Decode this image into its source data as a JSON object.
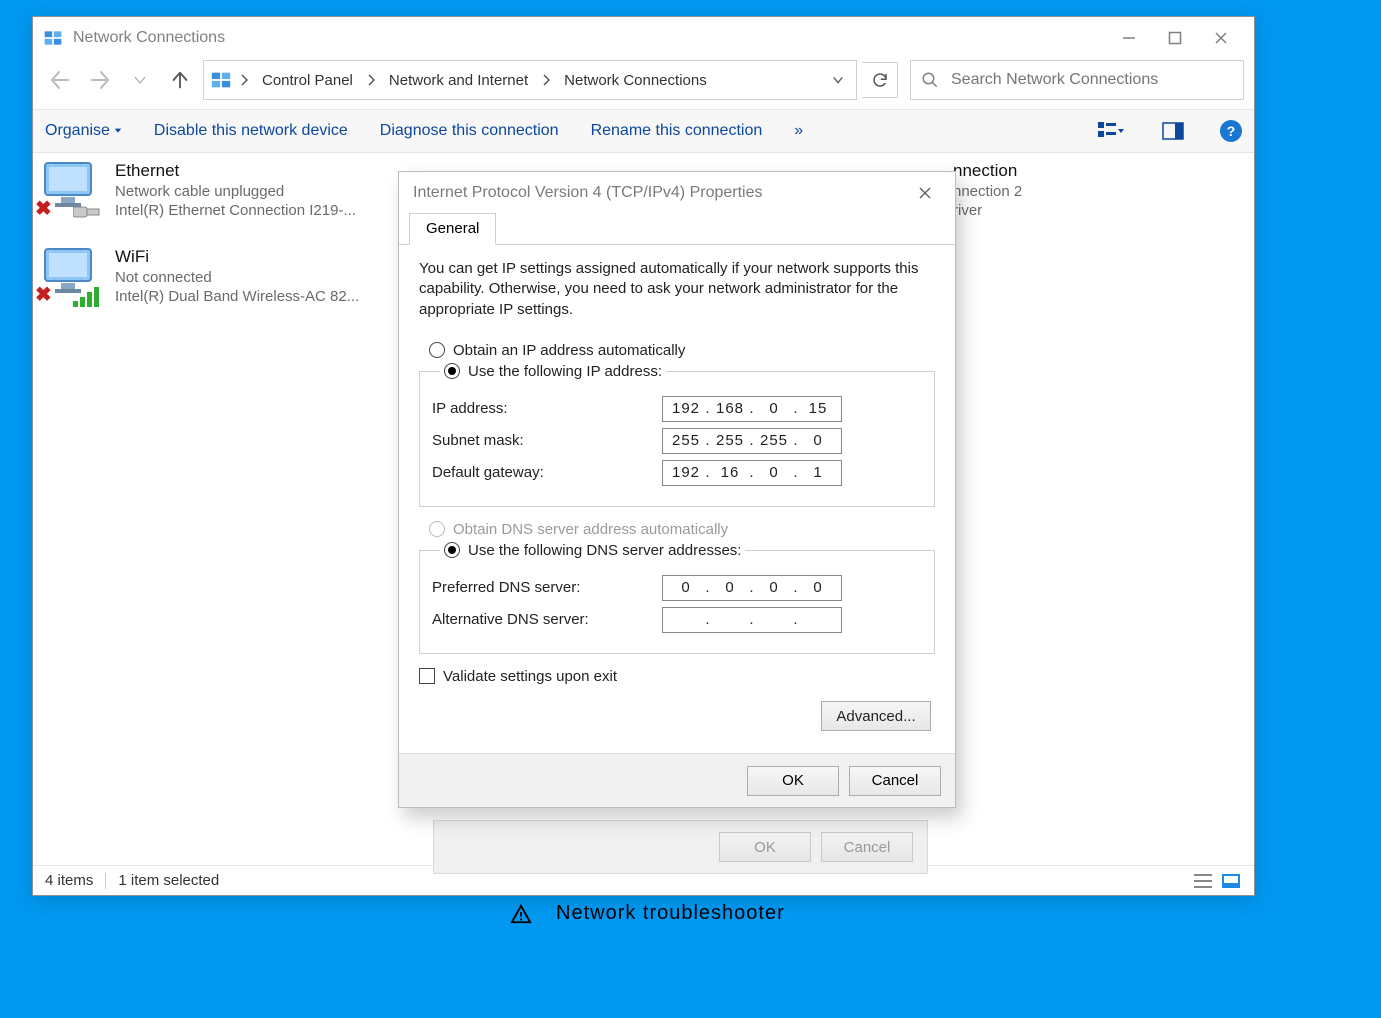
{
  "window": {
    "title": "Network Connections"
  },
  "breadcrumb": {
    "root": "Control Panel",
    "mid": "Network and Internet",
    "leaf": "Network Connections"
  },
  "search": {
    "placeholder": "Search Network Connections"
  },
  "commands": {
    "organise": "Organise",
    "disable": "Disable this network device",
    "diagnose": "Diagnose this connection",
    "rename": "Rename this connection",
    "more": "»"
  },
  "items": {
    "ethernet": {
      "title": "Ethernet",
      "status": "Network cable unplugged",
      "device": "Intel(R) Ethernet Connection I219-..."
    },
    "wifi": {
      "title": "WiFi",
      "status": "Not connected",
      "device": "Intel(R) Dual Band Wireless-AC 82..."
    },
    "bt": {
      "title_frag": "nnection",
      "sub1_frag": "nnection 2",
      "sub2_frag": "river"
    }
  },
  "statusbar": {
    "count": "4 items",
    "selection": "1 item selected"
  },
  "under_dialog": {
    "ok": "OK",
    "cancel": "Cancel"
  },
  "troubleshooter": "Network troubleshooter",
  "dialog": {
    "title": "Internet Protocol Version 4 (TCP/IPv4) Properties",
    "tab": "General",
    "intro": "You can get IP settings assigned automatically if your network supports this capability. Otherwise, you need to ask your network administrator for the appropriate IP settings.",
    "ip_auto": "Obtain an IP address automatically",
    "ip_manual": "Use the following IP address:",
    "ip_addr_label": "IP address:",
    "subnet_label": "Subnet mask:",
    "gateway_label": "Default gateway:",
    "ip_addr": {
      "o1": "192",
      "o2": "168",
      "o3": "0",
      "o4": "15"
    },
    "subnet": {
      "o1": "255",
      "o2": "255",
      "o3": "255",
      "o4": "0"
    },
    "gateway": {
      "o1": "192",
      "o2": "16",
      "o3": "0",
      "o4": "1"
    },
    "dns_auto": "Obtain DNS server address automatically",
    "dns_manual": "Use the following DNS server addresses:",
    "pref_dns_label": "Preferred DNS server:",
    "alt_dns_label": "Alternative DNS server:",
    "pref_dns": {
      "o1": "0",
      "o2": "0",
      "o3": "0",
      "o4": "0"
    },
    "alt_dns": {
      "o1": "",
      "o2": "",
      "o3": "",
      "o4": ""
    },
    "validate": "Validate settings upon exit",
    "advanced": "Advanced...",
    "ok": "OK",
    "cancel": "Cancel"
  }
}
